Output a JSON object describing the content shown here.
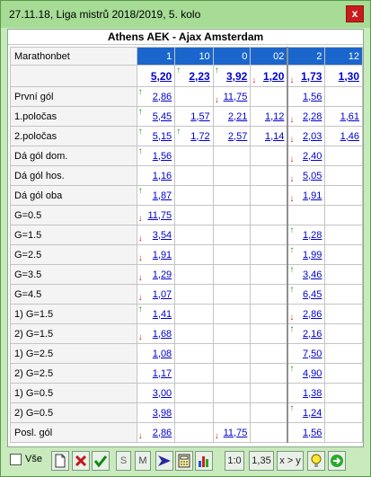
{
  "window": {
    "title": "27.11.18, Liga mistrů 2018/2019, 5. kolo",
    "close_label": "x"
  },
  "match": {
    "title": "Athens AEK - Ajax Amsterdam"
  },
  "bookmaker": "Marathonbet",
  "columns": [
    "1",
    "10",
    "0",
    "02",
    "2",
    "12"
  ],
  "rows": [
    {
      "label": "",
      "cells": [
        {
          "v": "5,20",
          "a": ""
        },
        {
          "v": "2,23",
          "a": "up"
        },
        {
          "v": "3,92",
          "a": "up"
        },
        {
          "v": "1,20",
          "a": "dn"
        },
        {
          "v": "1,73",
          "a": "dn"
        },
        {
          "v": "1,30",
          "a": ""
        }
      ]
    },
    {
      "label": "První gól",
      "cells": [
        {
          "v": "2,86",
          "a": "up"
        },
        {
          "v": "",
          "a": ""
        },
        {
          "v": "11,75",
          "a": "dn"
        },
        {
          "v": "",
          "a": ""
        },
        {
          "v": "1,56",
          "a": ""
        },
        {
          "v": "",
          "a": ""
        }
      ]
    },
    {
      "label": "1.poločas",
      "cells": [
        {
          "v": "5,45",
          "a": "up"
        },
        {
          "v": "1,57",
          "a": ""
        },
        {
          "v": "2,21",
          "a": ""
        },
        {
          "v": "1,12",
          "a": ""
        },
        {
          "v": "2,28",
          "a": "dn"
        },
        {
          "v": "1,61",
          "a": ""
        }
      ]
    },
    {
      "label": "2.poločas",
      "cells": [
        {
          "v": "5,15",
          "a": "up"
        },
        {
          "v": "1,72",
          "a": "up"
        },
        {
          "v": "2,57",
          "a": ""
        },
        {
          "v": "1,14",
          "a": ""
        },
        {
          "v": "2,03",
          "a": "dn"
        },
        {
          "v": "1,46",
          "a": ""
        }
      ]
    },
    {
      "label": "Dá gól dom.",
      "cells": [
        {
          "v": "1,56",
          "a": "up"
        },
        {
          "v": "",
          "a": ""
        },
        {
          "v": "",
          "a": ""
        },
        {
          "v": "",
          "a": ""
        },
        {
          "v": "2,40",
          "a": "dn"
        },
        {
          "v": "",
          "a": ""
        }
      ]
    },
    {
      "label": "Dá gól hos.",
      "cells": [
        {
          "v": "1,16",
          "a": ""
        },
        {
          "v": "",
          "a": ""
        },
        {
          "v": "",
          "a": ""
        },
        {
          "v": "",
          "a": ""
        },
        {
          "v": "5,05",
          "a": "dn"
        },
        {
          "v": "",
          "a": ""
        }
      ]
    },
    {
      "label": "Dá gól oba",
      "cells": [
        {
          "v": "1,87",
          "a": "up"
        },
        {
          "v": "",
          "a": ""
        },
        {
          "v": "",
          "a": ""
        },
        {
          "v": "",
          "a": ""
        },
        {
          "v": "1,91",
          "a": "dn"
        },
        {
          "v": "",
          "a": ""
        }
      ]
    },
    {
      "label": "G=0.5",
      "cells": [
        {
          "v": "11,75",
          "a": "dn"
        },
        {
          "v": "",
          "a": ""
        },
        {
          "v": "",
          "a": ""
        },
        {
          "v": "",
          "a": ""
        },
        {
          "v": "",
          "a": ""
        },
        {
          "v": "",
          "a": ""
        }
      ]
    },
    {
      "label": "G=1.5",
      "cells": [
        {
          "v": "3,54",
          "a": "dn"
        },
        {
          "v": "",
          "a": ""
        },
        {
          "v": "",
          "a": ""
        },
        {
          "v": "",
          "a": ""
        },
        {
          "v": "1,28",
          "a": "up"
        },
        {
          "v": "",
          "a": ""
        }
      ]
    },
    {
      "label": "G=2.5",
      "cells": [
        {
          "v": "1,91",
          "a": "dn"
        },
        {
          "v": "",
          "a": ""
        },
        {
          "v": "",
          "a": ""
        },
        {
          "v": "",
          "a": ""
        },
        {
          "v": "1,99",
          "a": "up"
        },
        {
          "v": "",
          "a": ""
        }
      ]
    },
    {
      "label": "G=3.5",
      "cells": [
        {
          "v": "1,29",
          "a": "dn"
        },
        {
          "v": "",
          "a": ""
        },
        {
          "v": "",
          "a": ""
        },
        {
          "v": "",
          "a": ""
        },
        {
          "v": "3,46",
          "a": "up"
        },
        {
          "v": "",
          "a": ""
        }
      ]
    },
    {
      "label": "G=4.5",
      "cells": [
        {
          "v": "1,07",
          "a": "dn"
        },
        {
          "v": "",
          "a": ""
        },
        {
          "v": "",
          "a": ""
        },
        {
          "v": "",
          "a": ""
        },
        {
          "v": "6,45",
          "a": "up"
        },
        {
          "v": "",
          "a": ""
        }
      ]
    },
    {
      "label": "1) G=1.5",
      "cells": [
        {
          "v": "1,41",
          "a": "up"
        },
        {
          "v": "",
          "a": ""
        },
        {
          "v": "",
          "a": ""
        },
        {
          "v": "",
          "a": ""
        },
        {
          "v": "2,86",
          "a": "dn"
        },
        {
          "v": "",
          "a": ""
        }
      ]
    },
    {
      "label": "2) G=1.5",
      "cells": [
        {
          "v": "1,68",
          "a": "dn"
        },
        {
          "v": "",
          "a": ""
        },
        {
          "v": "",
          "a": ""
        },
        {
          "v": "",
          "a": ""
        },
        {
          "v": "2,16",
          "a": "up"
        },
        {
          "v": "",
          "a": ""
        }
      ]
    },
    {
      "label": "1) G=2.5",
      "cells": [
        {
          "v": "1,08",
          "a": ""
        },
        {
          "v": "",
          "a": ""
        },
        {
          "v": "",
          "a": ""
        },
        {
          "v": "",
          "a": ""
        },
        {
          "v": "7,50",
          "a": ""
        },
        {
          "v": "",
          "a": ""
        }
      ]
    },
    {
      "label": "2) G=2.5",
      "cells": [
        {
          "v": "1,17",
          "a": ""
        },
        {
          "v": "",
          "a": ""
        },
        {
          "v": "",
          "a": ""
        },
        {
          "v": "",
          "a": ""
        },
        {
          "v": "4,90",
          "a": "up"
        },
        {
          "v": "",
          "a": ""
        }
      ]
    },
    {
      "label": "1) G=0.5",
      "cells": [
        {
          "v": "3,00",
          "a": ""
        },
        {
          "v": "",
          "a": ""
        },
        {
          "v": "",
          "a": ""
        },
        {
          "v": "",
          "a": ""
        },
        {
          "v": "1,38",
          "a": ""
        },
        {
          "v": "",
          "a": ""
        }
      ]
    },
    {
      "label": "2) G=0.5",
      "cells": [
        {
          "v": "3,98",
          "a": ""
        },
        {
          "v": "",
          "a": ""
        },
        {
          "v": "",
          "a": ""
        },
        {
          "v": "",
          "a": ""
        },
        {
          "v": "1,24",
          "a": "up"
        },
        {
          "v": "",
          "a": ""
        }
      ]
    },
    {
      "label": "Posl. gól",
      "cells": [
        {
          "v": "2,86",
          "a": "dn"
        },
        {
          "v": "",
          "a": ""
        },
        {
          "v": "11,75",
          "a": "dn"
        },
        {
          "v": "",
          "a": ""
        },
        {
          "v": "1,56",
          "a": ""
        },
        {
          "v": "",
          "a": ""
        }
      ]
    }
  ],
  "toolbar": {
    "all_label": "Vše",
    "s_label": "S",
    "m_label": "M",
    "ratio_label": "1:0",
    "odds_label": "1,35",
    "compare_label": "x > y"
  },
  "icons": {
    "new": "new-document-icon",
    "delete": "delete-x-icon",
    "confirm": "checkmark-icon",
    "arrow": "arrow-right-icon",
    "calc": "calculator-icon",
    "chart": "bar-chart-icon",
    "idea": "lightbulb-icon",
    "go": "go-arrow-icon"
  }
}
